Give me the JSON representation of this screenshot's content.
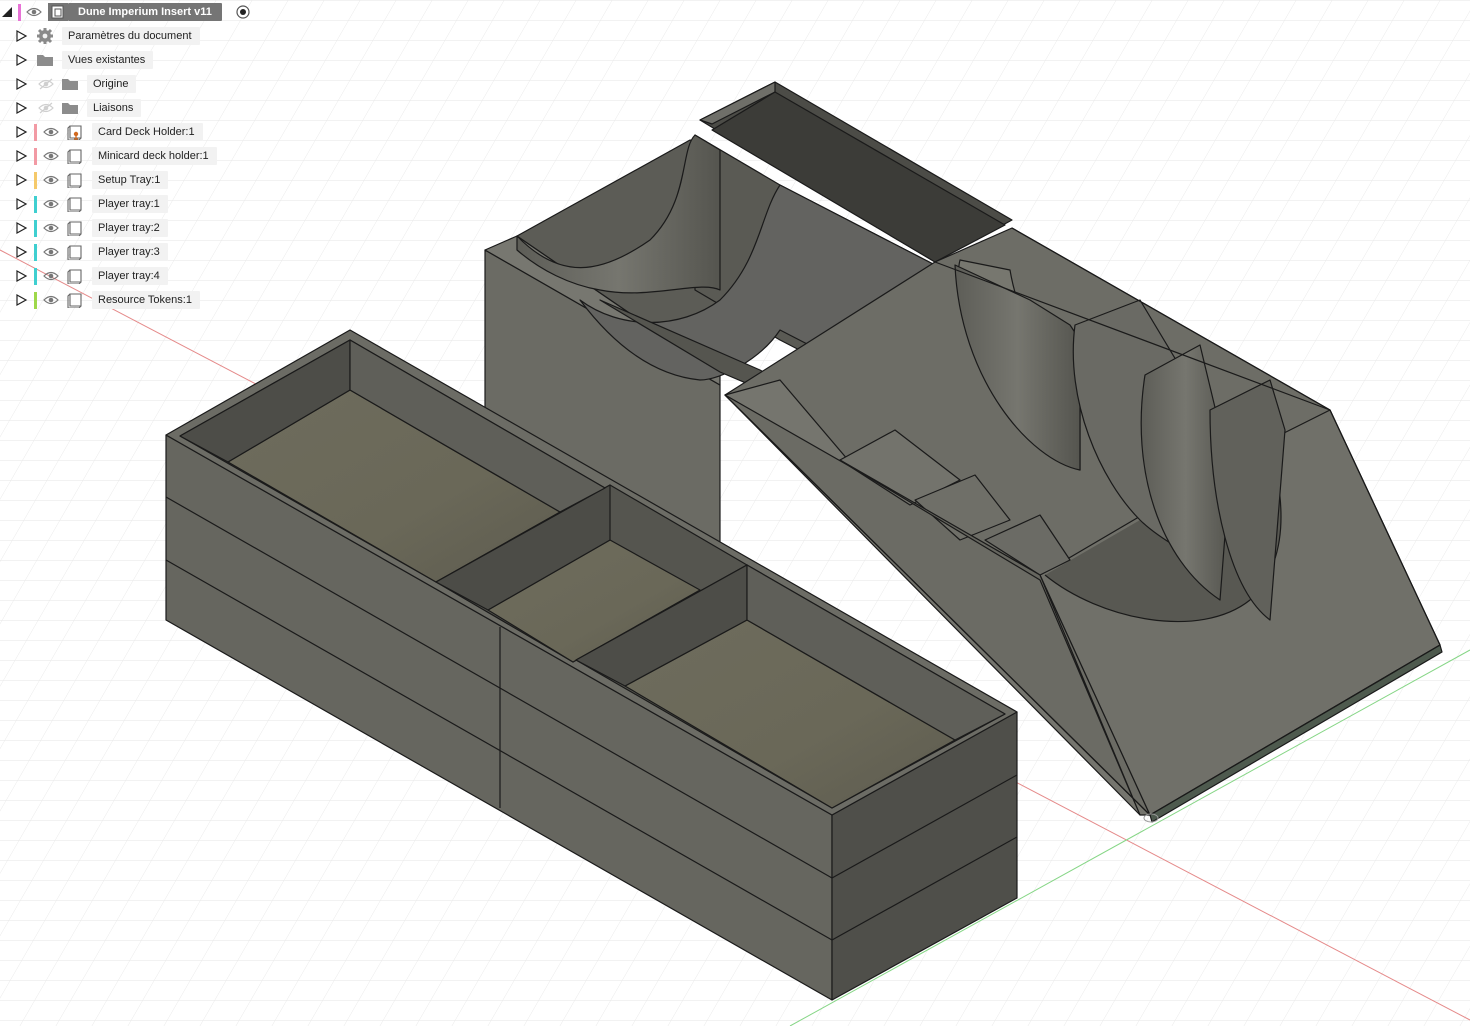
{
  "browser": {
    "root": {
      "name": "Dune Imperium Insert v11",
      "color": "#e873d6"
    },
    "folders": [
      {
        "label": "Paramètres du document",
        "icon": "gear-icon",
        "visibility": "none"
      },
      {
        "label": "Vues existantes",
        "icon": "folder-icon",
        "visibility": "none"
      },
      {
        "label": "Origine",
        "icon": "folder-icon",
        "visibility": "hidden"
      },
      {
        "label": "Liaisons",
        "icon": "folder-icon",
        "visibility": "hidden"
      }
    ],
    "components": [
      {
        "label": "Card Deck Holder:1",
        "color": "#f29aa4",
        "icon": "component-active-icon"
      },
      {
        "label": "Minicard deck holder:1",
        "color": "#f29aa4",
        "icon": "component-icon"
      },
      {
        "label": "Setup Tray:1",
        "color": "#f5c96a",
        "icon": "component-icon"
      },
      {
        "label": "Player tray:1",
        "color": "#3fcfd0",
        "icon": "component-icon"
      },
      {
        "label": "Player tray:2",
        "color": "#3fcfd0",
        "icon": "component-icon"
      },
      {
        "label": "Player tray:3",
        "color": "#3fcfd0",
        "icon": "component-icon"
      },
      {
        "label": "Player tray:4",
        "color": "#3fcfd0",
        "icon": "component-icon"
      },
      {
        "label": "Resource Tokens:1",
        "color": "#9ed84a",
        "icon": "component-icon"
      }
    ]
  },
  "viewport": {
    "grid": true,
    "colors": {
      "background": "#ffffff",
      "grid": "#e6e6e6",
      "x_axis": "#e27c7c",
      "y_axis": "#7cd67c",
      "body_light": "#7a7a74",
      "body_mid": "#66665f",
      "body_dark": "#4b4b45",
      "floor": "#6a6859",
      "edge": "#1a1a1a"
    }
  }
}
